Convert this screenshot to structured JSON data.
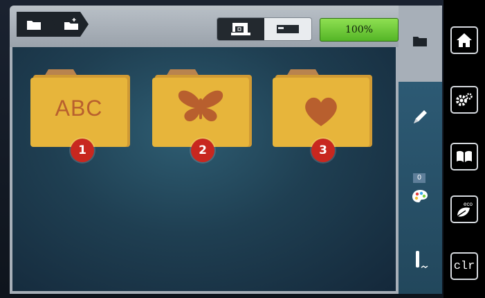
{
  "header": {
    "breadcrumb": [
      {
        "icon": "folder-icon"
      },
      {
        "icon": "folder-add-icon"
      }
    ],
    "mode_toggle": {
      "options": [
        "sewing-machine-icon",
        "embroidery-module-icon"
      ],
      "selected": "sewing-machine-icon"
    },
    "zoom_label": "100%"
  },
  "main": {
    "folders": [
      {
        "badge": "1",
        "label": "ABC",
        "icon": "alphabet-icon"
      },
      {
        "badge": "2",
        "label": "",
        "icon": "butterfly-icon"
      },
      {
        "badge": "3",
        "label": "",
        "icon": "heart-icon"
      }
    ]
  },
  "tools": {
    "counter": "0",
    "items": [
      "folder-icon",
      "pencil-icon",
      "color-palette-icon",
      "needle-icon"
    ]
  },
  "rail": {
    "items": [
      "home-icon",
      "settings-icon",
      "tutorial-book-icon",
      "eco-mode-icon"
    ],
    "clr_label": "clr"
  },
  "colors": {
    "folder": "#e7b53b",
    "folder_tab": "#b9834e",
    "motif": "#b85f2e",
    "badge": "#c8271f",
    "zoom_green": "#6cc93b"
  }
}
